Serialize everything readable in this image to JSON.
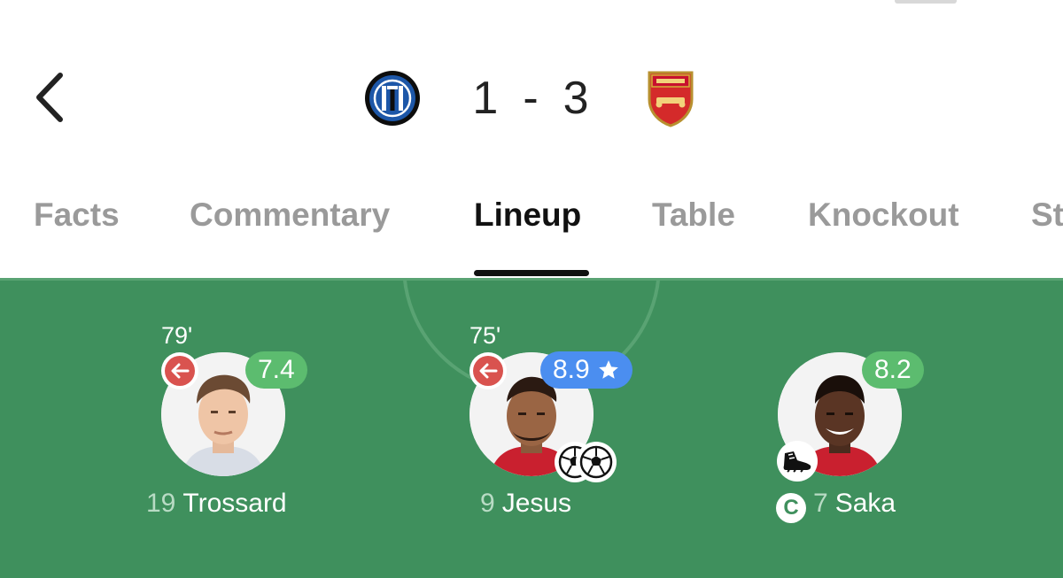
{
  "header": {
    "home_team": "Inter",
    "away_team": "Arsenal",
    "home_score": "1",
    "separator": "-",
    "away_score": "3"
  },
  "tabs": [
    {
      "label": "Facts",
      "active": false
    },
    {
      "label": "Commentary",
      "active": false
    },
    {
      "label": "Lineup",
      "active": true
    },
    {
      "label": "Table",
      "active": false
    },
    {
      "label": "Knockout",
      "active": false
    },
    {
      "label": "St",
      "active": false
    }
  ],
  "players": [
    {
      "number": "19",
      "name": "Trossard",
      "rating": "7.4",
      "rating_color": "#5cbc6f",
      "sub_minute": "79'",
      "subbed_off": true
    },
    {
      "number": "9",
      "name": "Jesus",
      "rating": "8.9",
      "rating_color": "#4b8ef0",
      "player_of_match": true,
      "sub_minute": "75'",
      "subbed_off": true,
      "goals": 2
    },
    {
      "number": "7",
      "name": "Saka",
      "rating": "8.2",
      "rating_color": "#5cbc6f",
      "captain": true,
      "captain_label": "C",
      "assist": true
    }
  ],
  "colors": {
    "pitch": "#3f905d",
    "pitch_lines": "#59a373",
    "sub_out": "#d9534f"
  },
  "icons": {
    "back": "chevron-left-icon",
    "sub_out": "arrow-left-icon",
    "star": "star-icon",
    "goal": "football-icon",
    "assist": "boot-icon",
    "captain": "captain-icon"
  }
}
